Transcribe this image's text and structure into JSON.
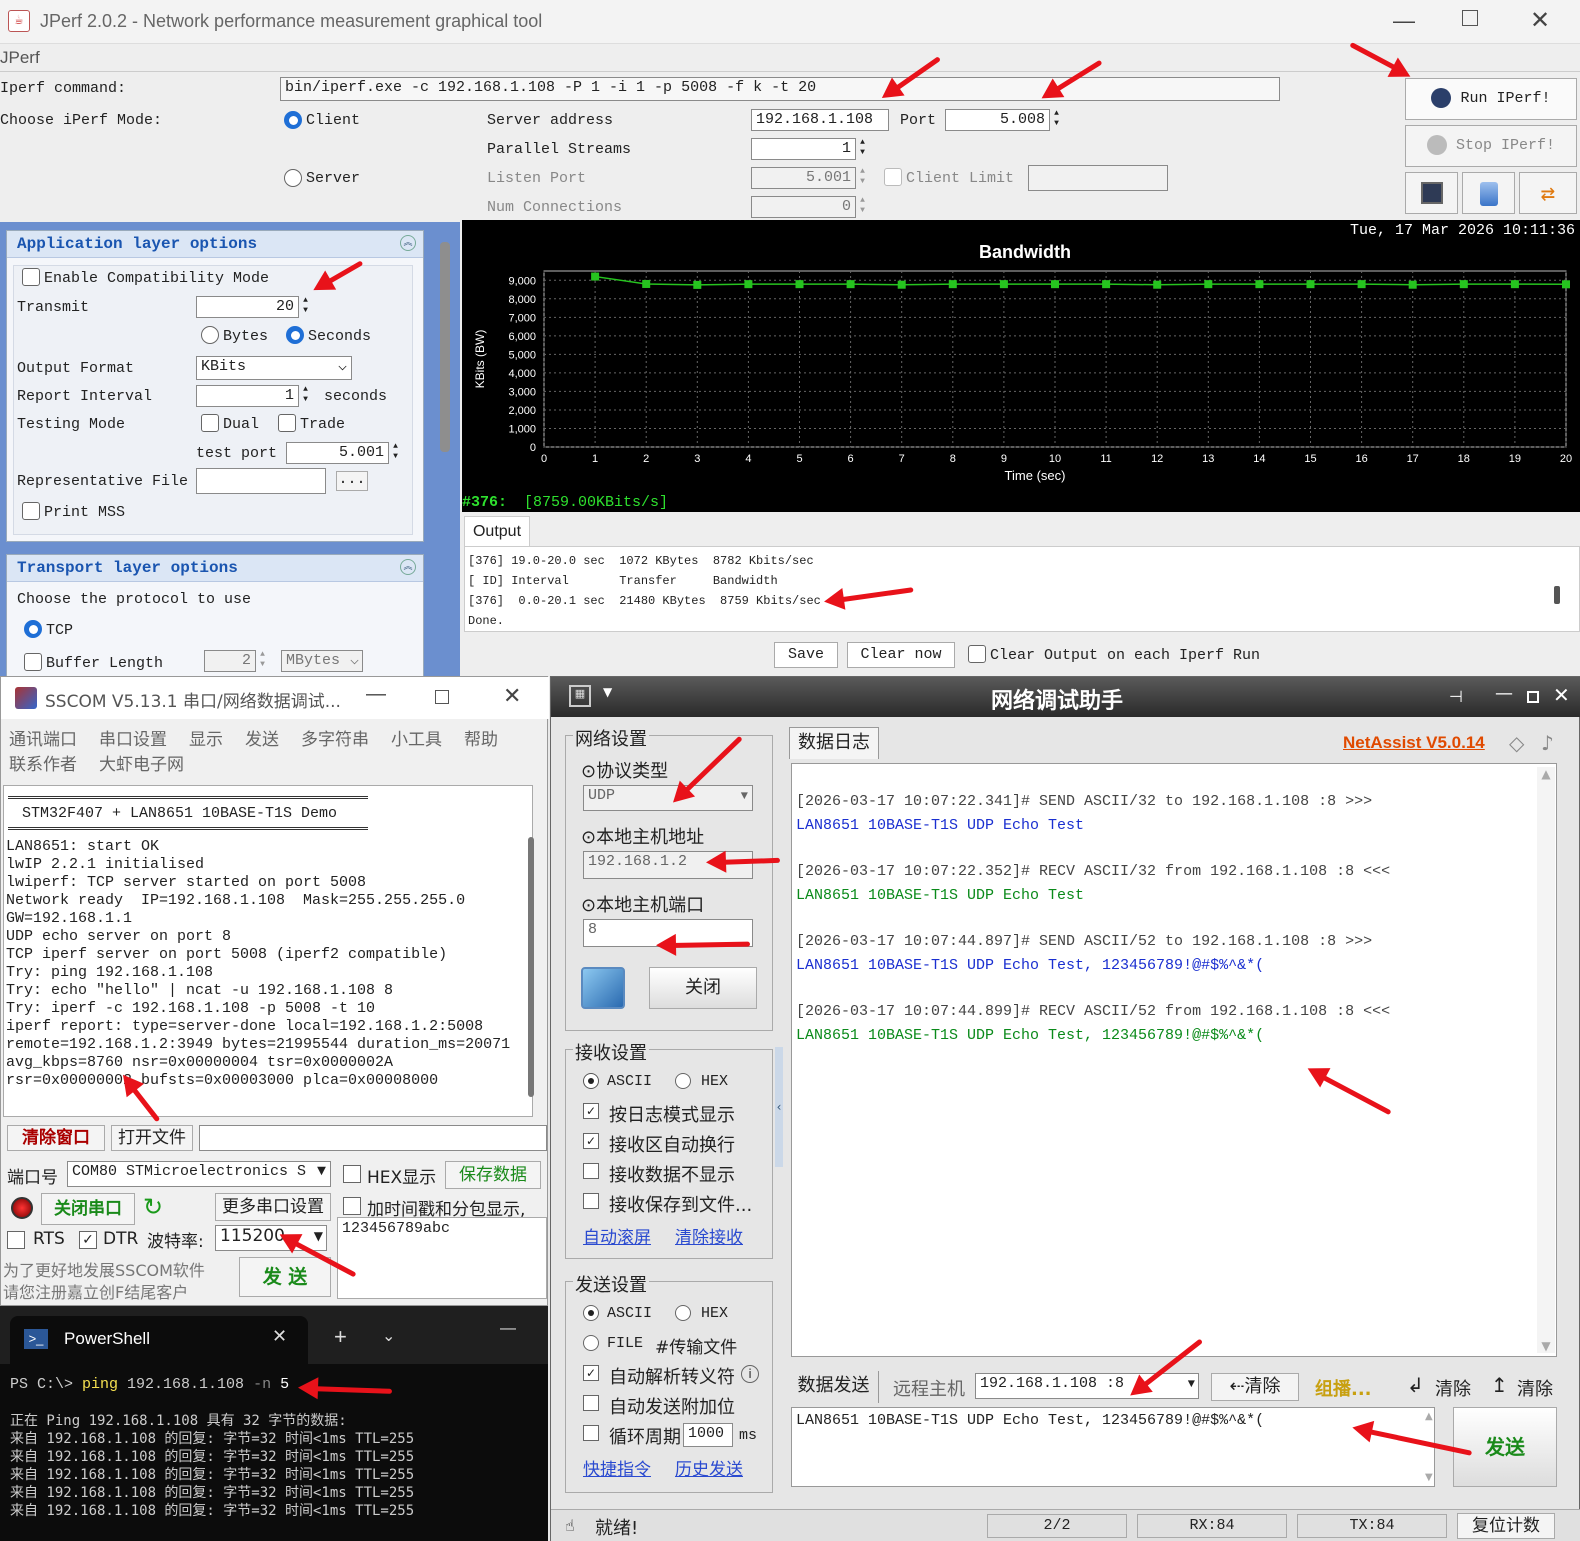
{
  "jperf": {
    "title": "JPerf 2.0.2 - Network performance measurement graphical tool",
    "menu": "JPerf",
    "cmd_label": "Iperf command:",
    "cmd_value": "bin/iperf.exe -c 192.168.1.108 -P 1 -i 1 -p 5008 -f k -t 20",
    "mode_label": "Choose iPerf Mode:",
    "client": "Client",
    "server": "Server",
    "server_address_label": "Server address",
    "server_address": "192.168.1.108",
    "port_label": "Port",
    "port": "5.008",
    "parallel_label": "Parallel Streams",
    "parallel": "1",
    "listen_label": "Listen Port",
    "listen": "5.001",
    "client_limit": "Client Limit",
    "numconn_label": "Num Connections",
    "numconn": "0",
    "run": "Run IPerf!",
    "stop": "Stop IPerf!",
    "app_hdr": "Application layer options",
    "compat": "Enable Compatibility Mode",
    "transmit_label": "Transmit",
    "transmit": "20",
    "bytes": "Bytes",
    "seconds": "Seconds",
    "outfmt_label": "Output Format",
    "outfmt": "KBits",
    "report_label": "Report Interval",
    "report": "1",
    "report_unit": "seconds",
    "testmode_label": "Testing Mode",
    "dual": "Dual",
    "trade": "Trade",
    "testport_label": "test port",
    "testport": "5.001",
    "repfile_label": "Representative File",
    "browse": "...",
    "mss": "Print MSS",
    "trans_hdr": "Transport layer options",
    "proto_label": "Choose the protocol to use",
    "tcp": "TCP",
    "buflen_label": "Buffer Length",
    "buflen": "2",
    "buflen_unit": "MBytes",
    "timestamp": "Tue, 17 Mar 2026 10:11:36",
    "status_id": "#376:",
    "status_val": "[8759.00KBits/s]",
    "output_tab": "Output",
    "output_lines": [
      "[376] 19.0-20.0 sec  1072 KBytes  8782 Kbits/sec",
      "[ ID] Interval       Transfer     Bandwidth",
      "[376]  0.0-20.1 sec  21480 KBytes  8759 Kbits/sec",
      "Done."
    ],
    "save": "Save",
    "clear": "Clear now",
    "clear_each": "Clear Output on each Iperf Run"
  },
  "chart_data": {
    "type": "line",
    "title": "Bandwidth",
    "xlabel": "Time (sec)",
    "ylabel": "KBits (BW)",
    "xlim": [
      0,
      20
    ],
    "ylim": [
      0,
      9500
    ],
    "x_ticks": [
      0,
      1,
      2,
      3,
      4,
      5,
      6,
      7,
      8,
      9,
      10,
      11,
      12,
      13,
      14,
      15,
      16,
      17,
      18,
      19,
      20
    ],
    "y_ticks": [
      0,
      1000,
      2000,
      3000,
      4000,
      5000,
      6000,
      7000,
      8000,
      9000
    ],
    "y_tick_labels": [
      "0",
      "1,000",
      "2,000",
      "3,000",
      "4,000",
      "5,000",
      "6,000",
      "7,000",
      "8,000",
      "9,000"
    ],
    "grid": true,
    "series": [
      {
        "x": [
          1,
          2,
          3,
          4,
          5,
          6,
          7,
          8,
          9,
          10,
          11,
          12,
          13,
          14,
          15,
          16,
          17,
          18,
          19,
          20
        ],
        "values": [
          9200,
          8800,
          8750,
          8790,
          8790,
          8790,
          8760,
          8790,
          8790,
          8790,
          8790,
          8760,
          8790,
          8790,
          8790,
          8790,
          8760,
          8790,
          8790,
          8782
        ],
        "color": "#26c41f"
      }
    ]
  },
  "sscom": {
    "title": "SSCOM V5.13.1 串口/网络数据调试...",
    "menu": [
      "通讯端口",
      "串口设置",
      "显示",
      "发送",
      "多字符串",
      "小工具",
      "帮助"
    ],
    "menu2": [
      "联系作者",
      "大虾电子网"
    ],
    "banner": "STM32F407 + LAN8651 10BASE-T1S Demo",
    "log": [
      "LAN8651: start OK",
      "lwIP 2.2.1 initialised",
      "lwiperf: TCP server started on port 5008",
      "Network ready  IP=192.168.1.108  Mask=255.255.255.0",
      "GW=192.168.1.1",
      "UDP echo server on port 8",
      "TCP iperf server on port 5008 (iperf2 compatible)",
      "Try: ping 192.168.1.108",
      "Try: echo \"hello\" | ncat -u 192.168.1.108 8",
      "Try: iperf -c 192.168.1.108 -p 5008 -t 10",
      "iperf report: type=server-done local=192.168.1.2:5008",
      "remote=192.168.1.2:3949 bytes=21995544 duration_ms=20071",
      "avg_kbps=8760 nsr=0x00000004 tsr=0x0000002A",
      "rsr=0x00000002 bufsts=0x00003000 plca=0x00008000"
    ],
    "clear_win": "清除窗口",
    "open_file": "打开文件",
    "port_label": "端口号",
    "port": "COM80 STMicroelectronics S",
    "hex_show": "HEX显示",
    "save_data": "保存数据",
    "close_port": "关闭串口",
    "more_settings": "更多串口设置",
    "add_ts": "加时间戳和分包显示,",
    "rts": "RTS",
    "dtr": "DTR",
    "baud_label": "波特率:",
    "baud": "115200",
    "send_text": "123456789abc",
    "promo1": "为了更好地发展SSCOM软件",
    "promo2": "请您注册嘉立创F结尾客户",
    "send": "发 送"
  },
  "ps": {
    "tab": "PowerShell",
    "prompt": "PS C:\\> ",
    "cmd": "ping",
    "args": " 192.168.1.108 ",
    "flag": "-n",
    "num": " 5",
    "lines": [
      "正在 Ping 192.168.1.108 具有 32 字节的数据:",
      "来自 192.168.1.108 的回复: 字节=32 时间<1ms TTL=255",
      "来自 192.168.1.108 的回复: 字节=32 时间<1ms TTL=255",
      "来自 192.168.1.108 的回复: 字节=32 时间<1ms TTL=255",
      "来自 192.168.1.108 的回复: 字节=32 时间<1ms TTL=255",
      "来自 192.168.1.108 的回复: 字节=32 时间<1ms TTL=255"
    ]
  },
  "netassist": {
    "title": "网络调试助手",
    "net_settings": "网络设置",
    "proto_label": "⊙协议类型",
    "proto": "UDP",
    "host_label": "⊙本地主机地址",
    "host": "192.168.1.2",
    "port_label": "⊙本地主机端口",
    "port": "8",
    "close": "关闭",
    "recv_settings": "接收设置",
    "ascii": "ASCII",
    "hex": "HEX",
    "recv_opts": [
      "按日志模式显示",
      "接收区自动换行",
      "接收数据不显示",
      "接收保存到文件..."
    ],
    "auto_scroll": "自动滚屏",
    "clear_recv": "清除接收",
    "send_settings": "发送设置",
    "file": "FILE",
    "transfer": "#传输文件",
    "send_opts": [
      "自动解析转义符",
      "自动发送附加位",
      "循环周期"
    ],
    "period": "1000",
    "ms": "ms",
    "quick": "快捷指令",
    "history": "历史发送",
    "ready": "就绪!",
    "log_tab": "数据日志",
    "version": "NetAssist V5.0.14",
    "log": [
      {
        "h": "[2026-03-17 10:07:22.341]# SEND ASCII/32 to 192.168.1.108 :8 >>>",
        "m": "LAN8651 10BASE-T1S UDP Echo Test",
        "c": "#1a2fd0"
      },
      {
        "h": "[2026-03-17 10:07:22.352]# RECV ASCII/32 from 192.168.1.108 :8 <<<",
        "m": "LAN8651 10BASE-T1S UDP Echo Test",
        "c": "#0a8a1a"
      },
      {
        "h": "[2026-03-17 10:07:44.897]# SEND ASCII/52 to 192.168.1.108 :8 >>>",
        "m": "LAN8651 10BASE-T1S UDP Echo Test, 123456789!@#$%^&*(",
        "c": "#1a2fd0"
      },
      {
        "h": "[2026-03-17 10:07:44.899]# RECV ASCII/52 from 192.168.1.108 :8 <<<",
        "m": "LAN8651 10BASE-T1S UDP Echo Test, 123456789!@#$%^&*(",
        "c": "#0a8a1a"
      }
    ],
    "send_tab": "数据发送",
    "remote_label": "远程主机",
    "remote": "192.168.1.108 :8",
    "clear1": "清除",
    "group": "组播...",
    "clear2": "清除",
    "clear3": "清除",
    "send_box": "LAN8651 10BASE-T1S UDP Echo Test, 123456789!@#$%^&*(",
    "send": "发送",
    "status_count": "2/2",
    "rx": "RX:84",
    "tx": "TX:84",
    "reset": "复位计数"
  }
}
